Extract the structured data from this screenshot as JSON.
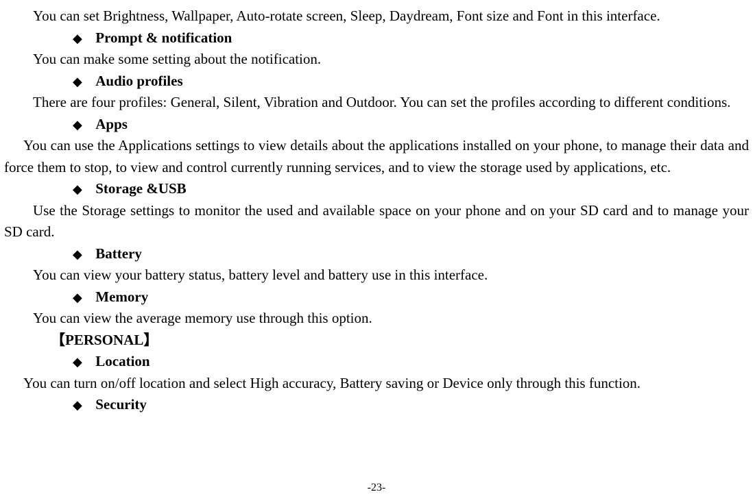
{
  "section_display": {
    "para1": "You can set Brightness, Wallpaper, Auto-rotate screen, Sleep, Daydream, Font size and Font in this interface.",
    "bullet1_title": "Prompt & notification",
    "para2": "You can make some setting about the notification.",
    "bullet2_title": "Audio profiles",
    "para3": "There are four profiles: General, Silent, Vibration and Outdoor. You can set the profiles according to different conditions.",
    "bullet3_title": "Apps",
    "para4": "You can use the Applications settings to view details about the applications installed on your phone, to manage their data and force them to stop, to view and control currently running services, and to view the storage used by applications, etc.",
    "bullet4_title": "Storage &USB",
    "para5": "Use the Storage settings to monitor the used and available space on your phone and on your SD card and to manage your SD card.",
    "bullet5_title": "Battery",
    "para6": "You can view your battery status, battery level and battery use in this interface.",
    "bullet6_title": "Memory",
    "para7": "You can view the average memory use through this option."
  },
  "section_personal": {
    "header": "【PERSONAL】",
    "bullet1_title": "Location",
    "para1": "You can turn on/off location and select High accuracy, Battery saving or Device only through this function.",
    "bullet2_title": "Security"
  },
  "page_number": "-23-"
}
